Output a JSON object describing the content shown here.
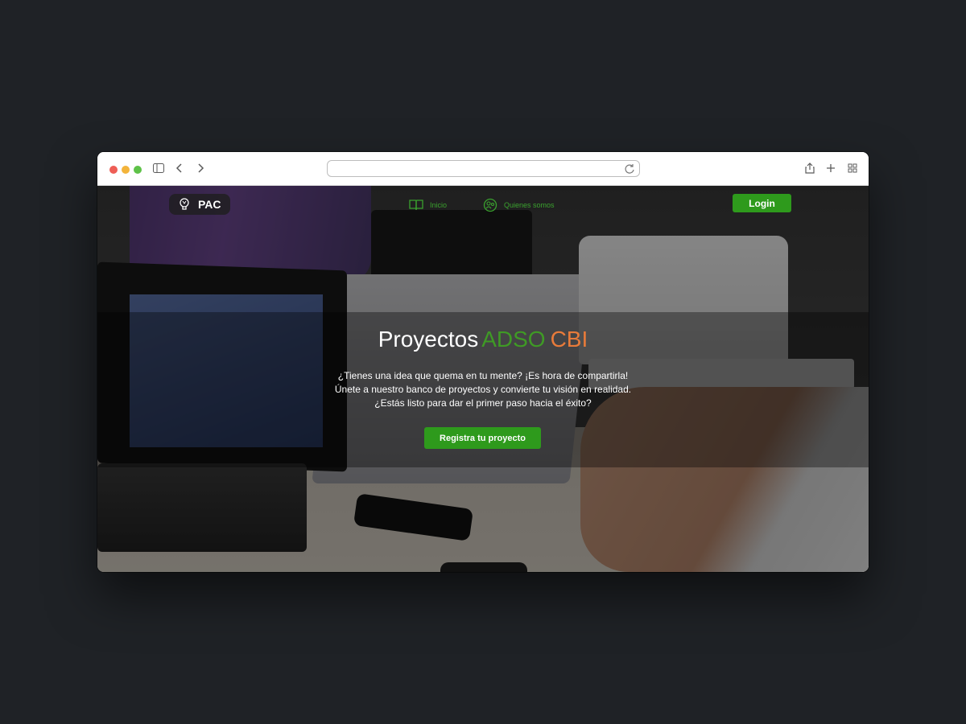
{
  "browser": {
    "url": "",
    "icons": [
      "sidebar-icon",
      "back-icon",
      "forward-icon",
      "reload-icon",
      "share-icon",
      "new-tab-icon",
      "tab-overview-icon"
    ]
  },
  "navbar": {
    "brand": "PAC",
    "items": [
      {
        "label": "Inicio",
        "icon": "book-icon"
      },
      {
        "label": "Quienes somos",
        "icon": "people-icon"
      }
    ],
    "login_label": "Login"
  },
  "hero": {
    "title_part1": "Proyectos",
    "title_part2": "ADSO",
    "title_part3": "CBI",
    "lines": [
      "¿Tienes una idea que quema en tu mente? ¡Es hora de compartirla!",
      "Únete a nuestro banco de proyectos y convierte tu visión en realidad.",
      "¿Estás listo para dar el primer paso hacia el éxito?"
    ],
    "cta_label": "Registra tu proyecto"
  },
  "colors": {
    "accent_green": "#2e9a1c",
    "title_green": "#3f9a25",
    "title_orange": "#e87b3a",
    "page_background": "#1f2226"
  }
}
